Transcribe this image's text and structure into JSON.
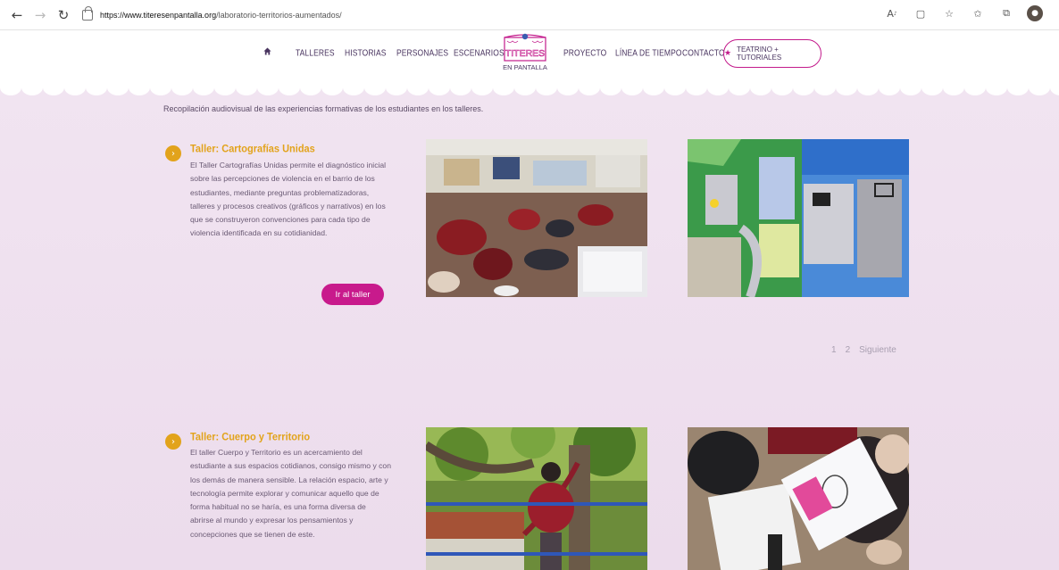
{
  "browser": {
    "url_domain": "https://www.titeresenpantalla.org",
    "url_path": "/laboratorio-territorios-aumentados/",
    "icons": [
      "back-icon",
      "forward-icon",
      "refresh-icon",
      "lock-icon",
      "read-aloud-icon",
      "immersive-reader-icon",
      "favorite-icon",
      "favorites-list-icon",
      "collections-icon",
      "profile-icon"
    ]
  },
  "nav": {
    "items": [
      {
        "label": "TALLERES"
      },
      {
        "label": "HISTORIAS"
      },
      {
        "label": "PERSONAJES"
      },
      {
        "label": "ESCENARIOS"
      },
      {
        "label": "PROYECTO"
      },
      {
        "label": "LÍNEA DE TIEMPO"
      },
      {
        "label": "CONTACTO"
      }
    ],
    "cta_label": "TEATRINO + TUTORIALES",
    "logo_line1": "TITERES",
    "logo_line2": "EN PANTALLA"
  },
  "intro": "Recopilación audiovisual de las experiencias formativas de los estudiantes en los talleres.",
  "sections": [
    {
      "title": "Taller: Cartografías Unidas",
      "description": "El Taller Cartografías Unidas permite el diagnóstico inicial sobre las percepciones de violencia en el barrio de los estudiantes, mediante preguntas problematizadoras, talleres y procesos creativos (gráficos y narrativos) en los que se construyeron convenciones para cada tipo de violencia identificada en su cotidianidad.",
      "button": "Ir al taller"
    },
    {
      "title": "Taller: Cuerpo y Territorio",
      "description": "El taller Cuerpo y Territorio es un acercamiento del estudiante a sus espacios cotidianos, consigo mismo y con los demás de manera sensible. La relación espacio, arte y tecnología permite explorar y comunicar aquello que de forma habitual no se haría, es una forma diversa de abrirse al mundo y expresar los pensamientos y concepciones que se tienen de este."
    }
  ],
  "pagination": {
    "page1": "1",
    "page2": "2",
    "next": "Siguiente"
  },
  "colors": {
    "accent": "#c81a8c",
    "gold": "#e2a31b",
    "background": "#efe1ef",
    "nav_text": "#4a3560"
  }
}
